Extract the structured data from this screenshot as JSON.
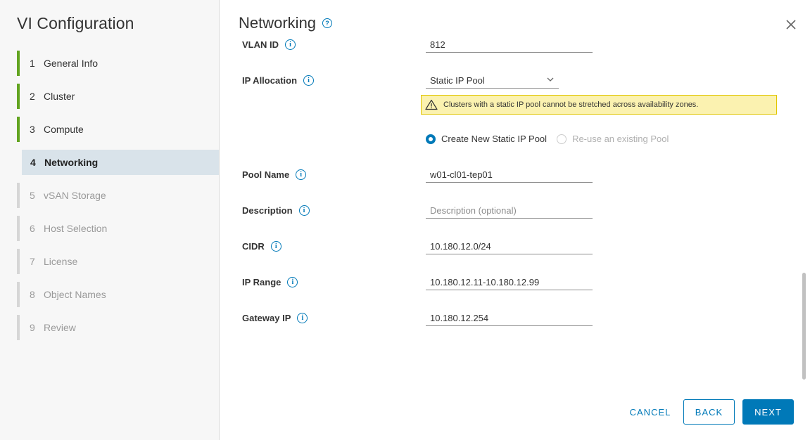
{
  "sidebar": {
    "title": "VI Configuration",
    "steps": [
      {
        "num": "1",
        "label": "General Info"
      },
      {
        "num": "2",
        "label": "Cluster"
      },
      {
        "num": "3",
        "label": "Compute"
      },
      {
        "num": "4",
        "label": "Networking"
      },
      {
        "num": "5",
        "label": "vSAN Storage"
      },
      {
        "num": "6",
        "label": "Host Selection"
      },
      {
        "num": "7",
        "label": "License"
      },
      {
        "num": "8",
        "label": "Object Names"
      },
      {
        "num": "9",
        "label": "Review"
      }
    ]
  },
  "page": {
    "title": "Networking",
    "help_glyph": "?"
  },
  "form": {
    "vlan": {
      "label": "VLAN ID",
      "value": "812"
    },
    "ip_allocation": {
      "label": "IP Allocation",
      "value": "Static IP Pool"
    },
    "alert": "Clusters with a static IP pool cannot be stretched across availability zones.",
    "radio": {
      "create_label": "Create New Static IP Pool",
      "reuse_label": "Re-use an existing Pool"
    },
    "pool_name": {
      "label": "Pool Name",
      "value": "w01-cl01-tep01"
    },
    "description": {
      "label": "Description",
      "value": "",
      "placeholder": "Description (optional)"
    },
    "cidr": {
      "label": "CIDR",
      "value": "10.180.12.0/24"
    },
    "ip_range": {
      "label": "IP Range",
      "value": "10.180.12.11-10.180.12.99"
    },
    "gateway": {
      "label": "Gateway IP",
      "value": "10.180.12.254"
    },
    "info_glyph": "i"
  },
  "footer": {
    "cancel": "CANCEL",
    "back": "BACK",
    "next": "NEXT"
  },
  "colors": {
    "accent": "#0079b8",
    "done_step": "#62a420",
    "active_step_bg": "#d9e3ea",
    "alert_bg": "#fbf2b0"
  }
}
